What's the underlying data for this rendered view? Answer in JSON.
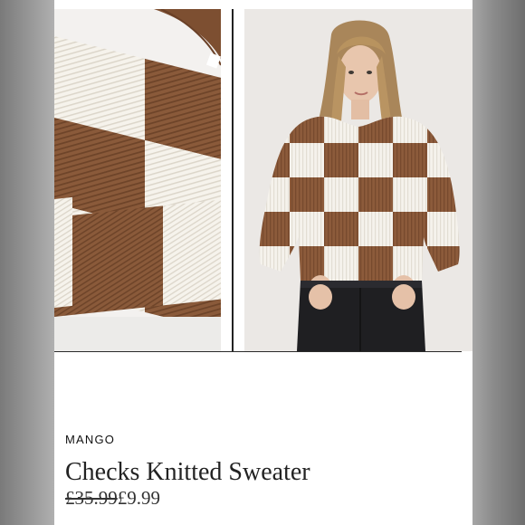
{
  "listing": {
    "brand": "MANGO",
    "title": "Checks Knitted Sweater",
    "original_price": "£35.99",
    "sale_price": "£9.99"
  },
  "colors": {
    "knit_brown": "#8a5a3a",
    "knit_cream": "#f4f1ea",
    "background": "#ffffff",
    "frame": "#8e8e8e"
  },
  "images": {
    "left": "folded-checkered-knit-closeup",
    "right": "model-wearing-checkered-sweater"
  }
}
